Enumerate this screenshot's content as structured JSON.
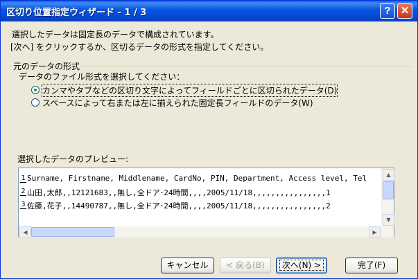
{
  "window": {
    "title": "区切り位置指定ウィザード - 1 / 3",
    "help_label": "?",
    "close_label": "✕"
  },
  "intro": {
    "line1": "選択したデータは固定長のデータで構成されています。",
    "line2": "[次へ] をクリックするか、区切るデータの形式を指定してください。"
  },
  "source_format": {
    "group_label": "元のデータの形式",
    "prompt": "データのファイル形式を選択してください：",
    "options": [
      {
        "label": "カンマやタブなどの区切り文字によってフィールドごとに区切られたデータ(D)",
        "selected": true
      },
      {
        "label": "スペースによって右または左に揃えられた固定長フィールドのデータ(W)",
        "selected": false
      }
    ]
  },
  "preview": {
    "label": "選択したデータのプレビュー:",
    "rows": [
      {
        "num": "1",
        "text": "Surname, Firstname, Middlename, CardNo, PIN, Department, Access level, Tel"
      },
      {
        "num": "2",
        "text": "山田,太郎,,12121683,,無し,全ドア･24時間,,,,2005/11/18,,,,,,,,,,,,,,,,1"
      },
      {
        "num": "3",
        "text": "佐藤,花子,,14490787,,無し,全ドア･24時間,,,,2005/11/18,,,,,,,,,,,,,,,,2"
      }
    ],
    "icons": {
      "up": "scroll-up-icon",
      "down": "scroll-down-icon",
      "left": "scroll-left-icon",
      "right": "scroll-right-icon"
    }
  },
  "buttons": {
    "cancel": "キャンセル",
    "back": "< 戻る(B)",
    "next": "次へ(N) >",
    "finish": "完了(F)"
  },
  "colors": {
    "titlebar": "#0855DD",
    "face": "#ECE9D8",
    "close": "#C5381A",
    "radio_dot": "#21A121"
  }
}
